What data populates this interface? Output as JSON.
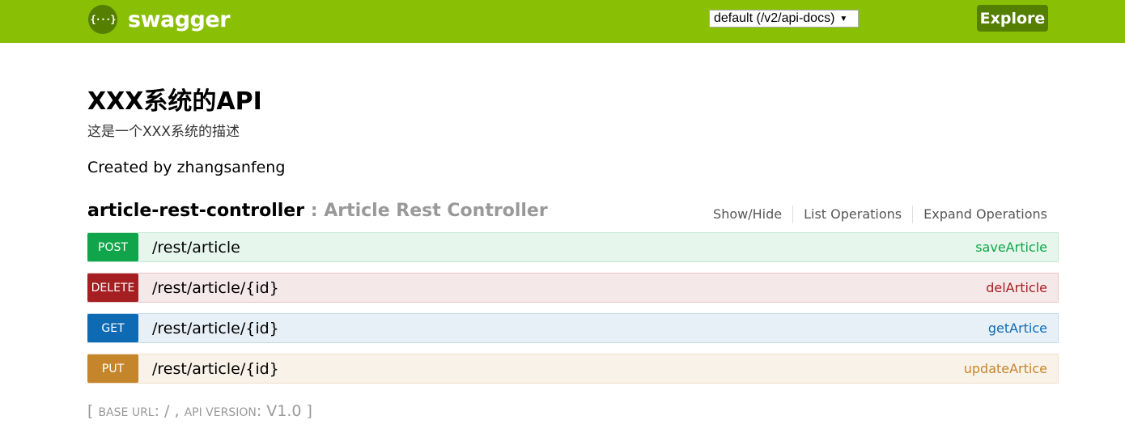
{
  "header": {
    "logo_glyph": "{···}",
    "logo_text": "swagger",
    "spec_select": {
      "selected": "default (/v2/api-docs)",
      "arrow": "▼"
    },
    "explore_label": "Explore",
    "colors": {
      "bar": "#89bf04",
      "button": "#547f00"
    }
  },
  "info": {
    "title": "XXX系统的API",
    "description": "这是一个XXX系统的描述",
    "contact": "Created by zhangsanfeng"
  },
  "resource": {
    "name": "article-rest-controller",
    "separator": " : ",
    "description": "Article Rest Controller",
    "actions": [
      "Show/Hide",
      "List Operations",
      "Expand Operations"
    ]
  },
  "operations": [
    {
      "method": "POST",
      "path": "/rest/article",
      "nickname": "saveArticle",
      "color": "#10a54a"
    },
    {
      "method": "DELETE",
      "path": "/rest/article/{id}",
      "nickname": "delArticle",
      "color": "#a41e22"
    },
    {
      "method": "GET",
      "path": "/rest/article/{id}",
      "nickname": "getArtice",
      "color": "#0f6ab4"
    },
    {
      "method": "PUT",
      "path": "/rest/article/{id}",
      "nickname": "updateArtice",
      "color": "#c5862b"
    }
  ],
  "footer": {
    "open": "[ ",
    "base_url_label": "Base URL",
    "base_url_value": ": / , ",
    "api_version_label": "API Version",
    "api_version_value": ": V1.0 ",
    "close": "]"
  }
}
